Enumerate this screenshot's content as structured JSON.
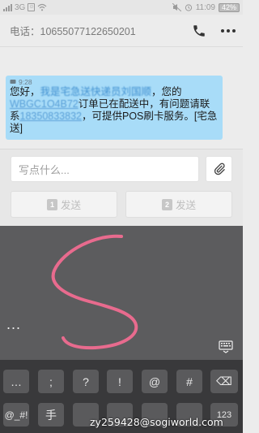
{
  "status_bar": {
    "carrier": "3G",
    "time": "11:09",
    "battery": "42%"
  },
  "header": {
    "title": "电话：10655077122650201"
  },
  "message": {
    "time": "9:28",
    "text_parts": [
      {
        "text": "您好，",
        "style": "plain"
      },
      {
        "text": "我是宅急送快递员刘国顺",
        "style": "blur"
      },
      {
        "text": "，您的",
        "style": "plain"
      },
      {
        "text": "WBGC1O4B72",
        "style": "blur2"
      },
      {
        "text": "订单已在配送中，有问题请联系",
        "style": "plain"
      },
      {
        "text": "18350833832",
        "style": "blur2"
      },
      {
        "text": "，可提供POS刷卡服务。[宅急送]",
        "style": "plain"
      }
    ]
  },
  "composer": {
    "placeholder": "写点什么...",
    "send1_label": "发送",
    "send1_sim": "1",
    "send2_label": "发送",
    "send2_sim": "2"
  },
  "handwriting": {
    "more": "..."
  },
  "keyboard": {
    "row1": [
      "…",
      ";",
      "?",
      "!",
      "@",
      "#",
      "⌫"
    ],
    "row2": [
      "@_#!",
      "手",
      "",
      "",
      "",
      "",
      "123"
    ]
  },
  "watermark": "zy259428@sogiworld.com",
  "colors": {
    "bubble": "#a8dcf8",
    "handwriting_stroke": "#e86b8e",
    "handwriting_bg": "#5c5c5e",
    "keyboard_bg": "#39393b"
  }
}
